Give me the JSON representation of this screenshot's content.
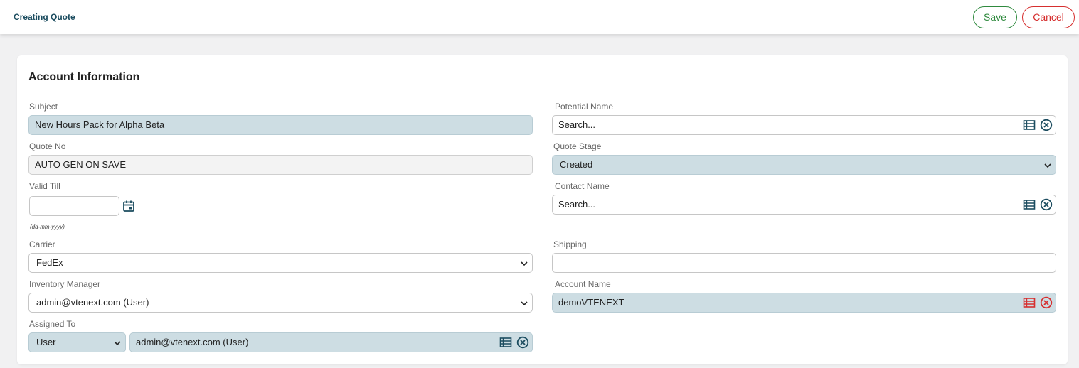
{
  "header": {
    "title": "Creating Quote",
    "save_label": "Save",
    "cancel_label": "Cancel"
  },
  "colors": {
    "accent": "#1b4c5f",
    "save": "#2f8a3e",
    "cancel": "#d62f2f",
    "filled": "#cddde3"
  },
  "section": {
    "title": "Account Information"
  },
  "fields": {
    "subject": {
      "label": "Subject",
      "value": "New Hours Pack for Alpha Beta"
    },
    "quote_no": {
      "label": "Quote No",
      "value": "AUTO GEN ON SAVE"
    },
    "valid_till": {
      "label": "Valid Till",
      "value": "",
      "hint": "(dd-mm-yyyy)"
    },
    "carrier": {
      "label": "Carrier",
      "value": "FedEx"
    },
    "inventory_manager": {
      "label": "Inventory Manager",
      "value": "admin@vtenext.com (User)"
    },
    "assigned_to": {
      "label": "Assigned To",
      "type_value": "User",
      "value": "admin@vtenext.com (User)"
    },
    "potential_name": {
      "label": "Potential Name",
      "placeholder": "Search..."
    },
    "quote_stage": {
      "label": "Quote Stage",
      "value": "Created"
    },
    "contact_name": {
      "label": "Contact Name",
      "placeholder": "Search..."
    },
    "shipping": {
      "label": "Shipping",
      "value": ""
    },
    "account_name": {
      "label": "Account Name",
      "value": "demoVTENEXT"
    }
  },
  "icons": {
    "list": "list-icon",
    "clear": "clear-circle-icon",
    "calendar": "calendar-icon",
    "dropdown": "chevron-down-icon"
  }
}
